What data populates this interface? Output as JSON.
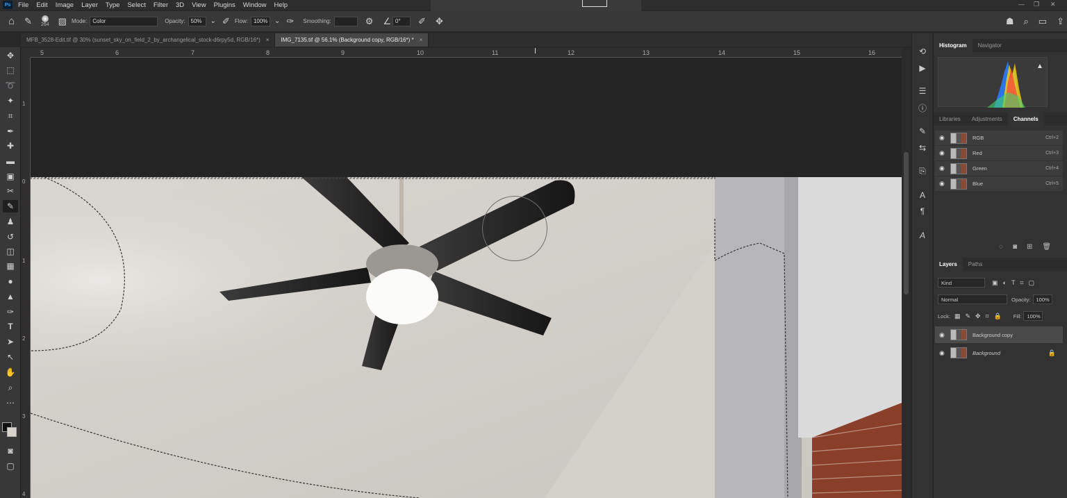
{
  "menu": {
    "app_icon": "Ps",
    "items": [
      "File",
      "Edit",
      "Image",
      "Layer",
      "Type",
      "Select",
      "Filter",
      "3D",
      "View",
      "Plugins",
      "Window",
      "Help"
    ]
  },
  "options": {
    "brush_size": "264",
    "mode_label": "Mode:",
    "mode_value": "Color",
    "opacity_label": "Opacity:",
    "opacity_value": "50%",
    "flow_label": "Flow:",
    "flow_value": "100%",
    "smoothing_label": "Smoothing:",
    "smoothing_value": "",
    "angle_value": "0°"
  },
  "tabs": [
    {
      "label": "MFB_3528-Edit.tif @ 30% (sunset_sky_on_field_2_by_archangelical_stock-d6rpy5d, RGB/16*)",
      "close": "×"
    },
    {
      "label": "IMG_7135.tif @ 56.1% (Background copy, RGB/16*) *",
      "close": "×"
    }
  ],
  "ruler": {
    "h": [
      "5",
      "6",
      "7",
      "8",
      "9",
      "10",
      "11",
      "12",
      "13",
      "14",
      "15",
      "16"
    ],
    "v": [
      "1",
      "0",
      "1",
      "2",
      "3",
      "4"
    ]
  },
  "panels": {
    "top_tabs": [
      "Histogram",
      "Navigator"
    ],
    "mid_tabs": [
      "Libraries",
      "Adjustments",
      "Channels"
    ],
    "channels": [
      {
        "name": "RGB",
        "shortcut": "Ctrl+2"
      },
      {
        "name": "Red",
        "shortcut": "Ctrl+3"
      },
      {
        "name": "Green",
        "shortcut": "Ctrl+4"
      },
      {
        "name": "Blue",
        "shortcut": "Ctrl+5"
      }
    ],
    "layer_tabs": [
      "Layers",
      "Paths"
    ],
    "kind_label": "Kind",
    "blend_mode": "Normal",
    "opacity_label": "Opacity:",
    "opacity_value": "100%",
    "lock_label": "Lock:",
    "fill_label": "Fill:",
    "fill_value": "100%",
    "layers": [
      {
        "name": "Background copy"
      },
      {
        "name": "Background"
      }
    ]
  },
  "colors": {
    "accent": "#31a8ff",
    "ui_bg": "#383838",
    "brick": "#8a3f2a"
  }
}
